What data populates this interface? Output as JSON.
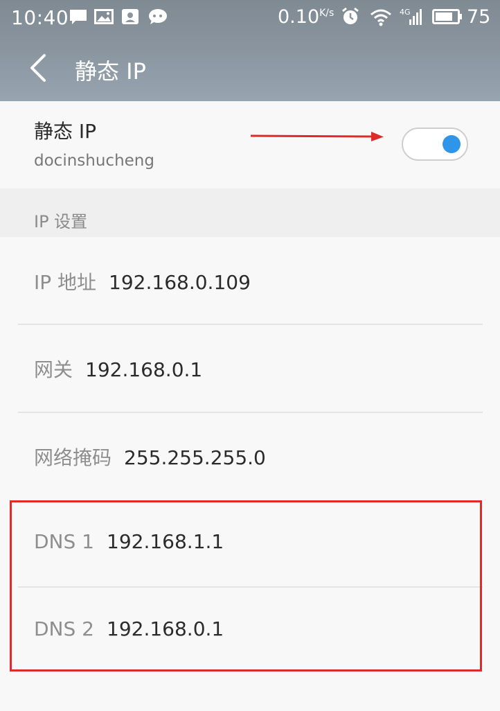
{
  "status_bar": {
    "time": "10:40",
    "net_speed": "0.10",
    "net_unit": "K/s",
    "battery": "75"
  },
  "nav": {
    "title": "静态 IP"
  },
  "static_ip": {
    "title": "静态 IP",
    "network_name": "docinshucheng",
    "enabled": true
  },
  "section": {
    "title": "IP 设置"
  },
  "fields": [
    {
      "label": "IP 地址",
      "value": "192.168.0.109"
    },
    {
      "label": "网关",
      "value": "192.168.0.1"
    },
    {
      "label": "网络掩码",
      "value": "255.255.255.0"
    },
    {
      "label": "DNS 1",
      "value": "192.168.1.1"
    },
    {
      "label": "DNS 2",
      "value": "192.168.0.1"
    }
  ],
  "colors": {
    "toggle_on": "#2e95e8",
    "annotation_red": "#e02a2a"
  }
}
